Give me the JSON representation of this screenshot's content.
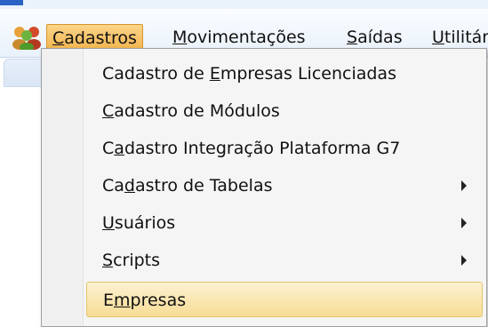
{
  "menubar": {
    "items": [
      {
        "id": "cadastros",
        "pre": "",
        "key": "C",
        "post": "adastros",
        "active": true
      },
      {
        "id": "movimentacoes",
        "pre": "",
        "key": "M",
        "post": "ovimentações"
      },
      {
        "id": "saidas",
        "pre": "",
        "key": "S",
        "post": "aídas"
      },
      {
        "id": "utilitarios",
        "pre": "",
        "key": "U",
        "post": "tilitár"
      }
    ]
  },
  "dropdown": {
    "items": [
      {
        "pre": "Cadastro de ",
        "key": "E",
        "post": "mpresas Licenciadas",
        "submenu": false
      },
      {
        "pre": "",
        "key": "C",
        "post": "adastro de Módulos",
        "submenu": false
      },
      {
        "pre": "C",
        "key": "a",
        "post": "dastro Integração Plataforma G7",
        "submenu": false
      },
      {
        "pre": "Ca",
        "key": "d",
        "post": "astro de Tabelas",
        "submenu": true
      },
      {
        "pre": "",
        "key": "U",
        "post": "suários",
        "submenu": true
      },
      {
        "pre": "",
        "key": "S",
        "post": "cripts",
        "submenu": true
      },
      {
        "pre": "E",
        "key": "m",
        "post": "presas",
        "submenu": false,
        "highlighted": true
      }
    ]
  },
  "colors": {
    "active_menu": "#f2b24a",
    "highlight": "#f7dc96",
    "menubar": "#e9f1fb"
  },
  "icons": {
    "app": "people-group-icon",
    "submenu": "submenu-arrow-icon"
  }
}
